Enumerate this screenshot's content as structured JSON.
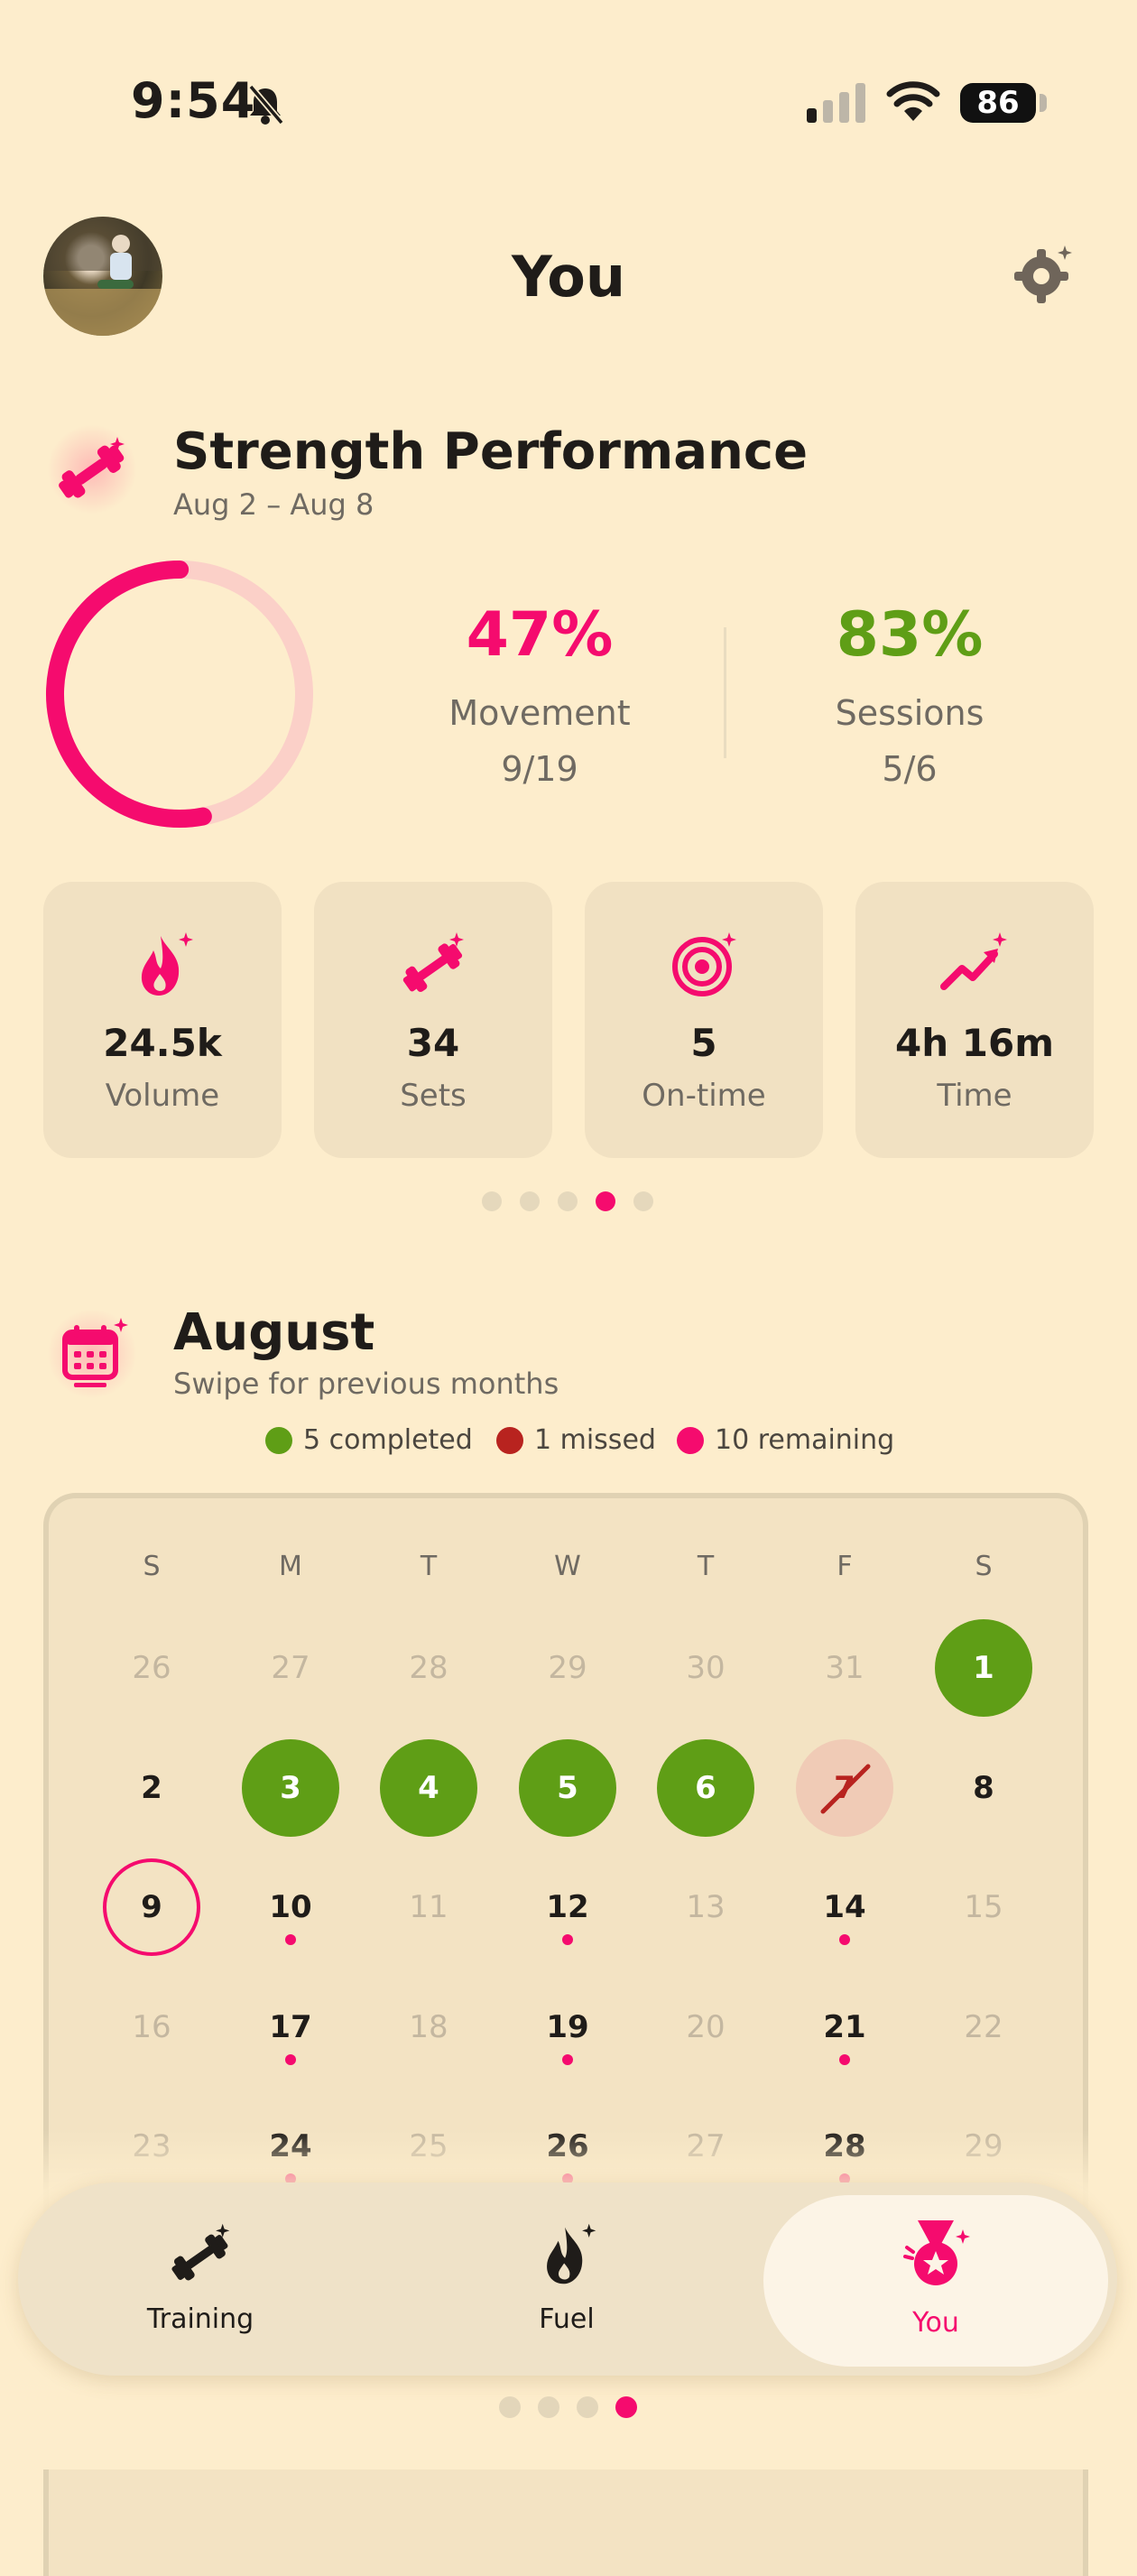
{
  "status_bar": {
    "time": "9:54",
    "battery": "86"
  },
  "header": {
    "title": "You"
  },
  "strength": {
    "title": "Strength Performance",
    "date_range": "Aug 2 – Aug 8",
    "ring_progress": 0.47,
    "movement": {
      "percent": "47%",
      "label": "Movement",
      "fraction": "9/19"
    },
    "sessions": {
      "percent": "83%",
      "label": "Sessions",
      "fraction": "5/6"
    }
  },
  "stats": [
    {
      "value": "24.5k",
      "label": "Volume",
      "icon": "flame-icon"
    },
    {
      "value": "34",
      "label": "Sets",
      "icon": "dumbbell-icon"
    },
    {
      "value": "5",
      "label": "On-time",
      "icon": "target-icon"
    },
    {
      "value": "4h 16m",
      "label": "Time",
      "icon": "trend-up-icon"
    }
  ],
  "stats_pager": {
    "count": 5,
    "active": 3
  },
  "calendar": {
    "title": "August",
    "subtitle": "Swipe for previous months",
    "legend": [
      {
        "label": "5 completed",
        "color": "#5f9e16"
      },
      {
        "label": "1 missed",
        "color": "#b8231f"
      },
      {
        "label": "10 remaining",
        "color": "#f50b6e"
      }
    ],
    "weekdays": [
      "S",
      "M",
      "T",
      "W",
      "T",
      "F",
      "S"
    ],
    "weeks": [
      [
        "26",
        "27",
        "28",
        "29",
        "30",
        "31",
        "1"
      ],
      [
        "2",
        "3",
        "4",
        "5",
        "6",
        "7",
        "8"
      ],
      [
        "9",
        "10",
        "11",
        "12",
        "13",
        "14",
        "15"
      ],
      [
        "16",
        "17",
        "18",
        "19",
        "20",
        "21",
        "22"
      ],
      [
        "23",
        "24",
        "25",
        "26",
        "27",
        "28",
        "29"
      ]
    ]
  },
  "nav": {
    "tabs": [
      {
        "label": "Training",
        "icon": "dumbbell-icon"
      },
      {
        "label": "Fuel",
        "icon": "flame-icon"
      },
      {
        "label": "You",
        "icon": "medal-icon"
      }
    ],
    "active": 2
  },
  "page_dots": {
    "count": 4,
    "active": 3
  },
  "colors": {
    "accent": "#f50b6e",
    "success": "#5f9e16",
    "missed": "#b8231f",
    "background": "#fdedcc"
  }
}
